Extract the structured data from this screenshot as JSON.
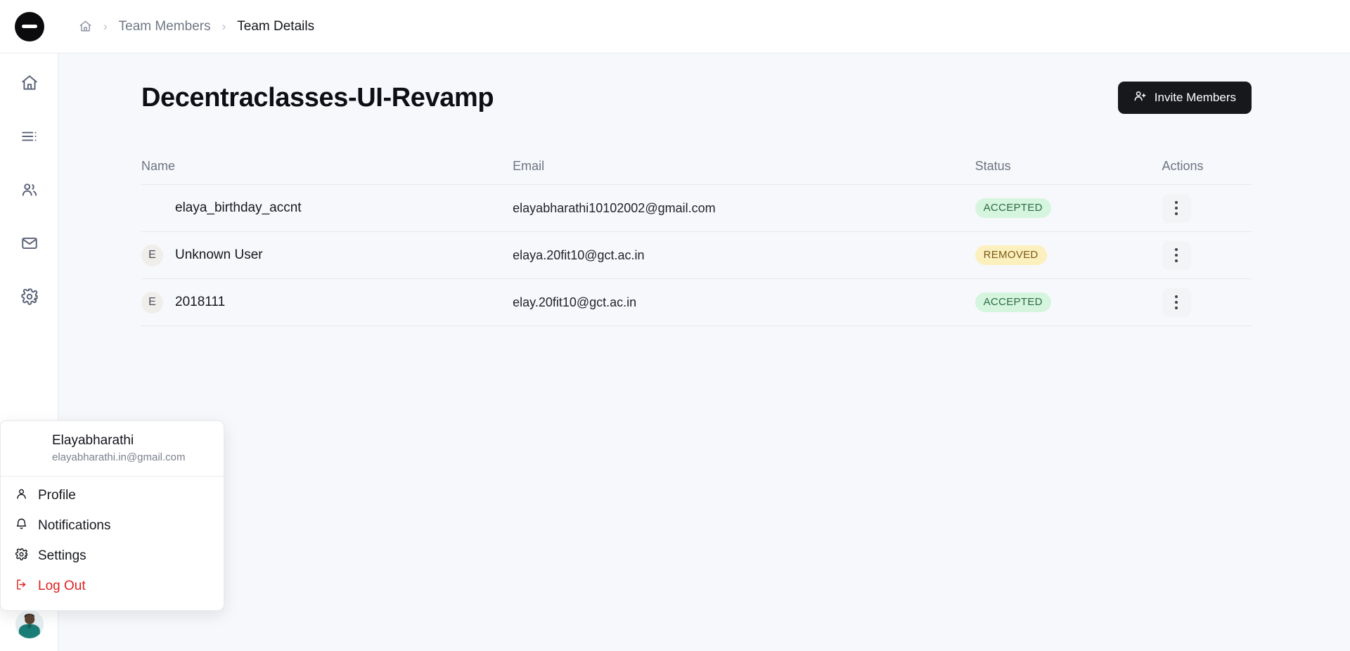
{
  "app": {
    "logo_icon": "circle-minus-logo",
    "background_color": "#f7f8fb",
    "accent_color": "#17181c"
  },
  "breadcrumb": {
    "home_icon": "home-icon",
    "separator": "›",
    "parent": "Team Members",
    "current": "Team Details"
  },
  "sidebar": {
    "items": [
      {
        "name": "home",
        "icon": "home-icon"
      },
      {
        "name": "list",
        "icon": "list-icon"
      },
      {
        "name": "members",
        "icon": "users-icon"
      },
      {
        "name": "mail",
        "icon": "mail-icon"
      },
      {
        "name": "settings",
        "icon": "gear-icon"
      }
    ],
    "avatar_icon": "user-avatar-photo"
  },
  "header": {
    "title": "Decentraclasses-UI-Revamp",
    "invite_button": {
      "label": "Invite Members",
      "icon": "user-plus-icon"
    }
  },
  "table": {
    "columns": [
      "Name",
      "Email",
      "Status",
      "Actions"
    ],
    "rows": [
      {
        "avatar_type": "image",
        "avatar_letter": "",
        "name": "elaya_birthday_accnt",
        "email": "elayabharathi10102002@gmail.com",
        "status": "ACCEPTED",
        "status_bg": "#d6f5df",
        "status_fg": "#2c6b42"
      },
      {
        "avatar_type": "letter",
        "avatar_letter": "E",
        "name": "Unknown User",
        "email": "elaya.20fit10@gct.ac.in",
        "status": "REMOVED",
        "status_bg": "#fcf0bf",
        "status_fg": "#7a5a17"
      },
      {
        "avatar_type": "letter",
        "avatar_letter": "E",
        "name": "2018111",
        "email": "elay.20fit10@gct.ac.in",
        "status": "ACCEPTED",
        "status_bg": "#d6f5df",
        "status_fg": "#2c6b42"
      }
    ],
    "row_action_icon": "kebab-menu-icon"
  },
  "profile_menu": {
    "user_name": "Elayabharathi",
    "user_email": "elayabharathi.in@gmail.com",
    "avatar_icon": "user-avatar-photo",
    "items": [
      {
        "label": "Profile",
        "icon": "person-icon"
      },
      {
        "label": "Notifications",
        "icon": "bell-icon"
      },
      {
        "label": "Settings",
        "icon": "gear-icon"
      },
      {
        "label": "Log Out",
        "icon": "logout-icon",
        "color": "#e02020"
      }
    ]
  }
}
